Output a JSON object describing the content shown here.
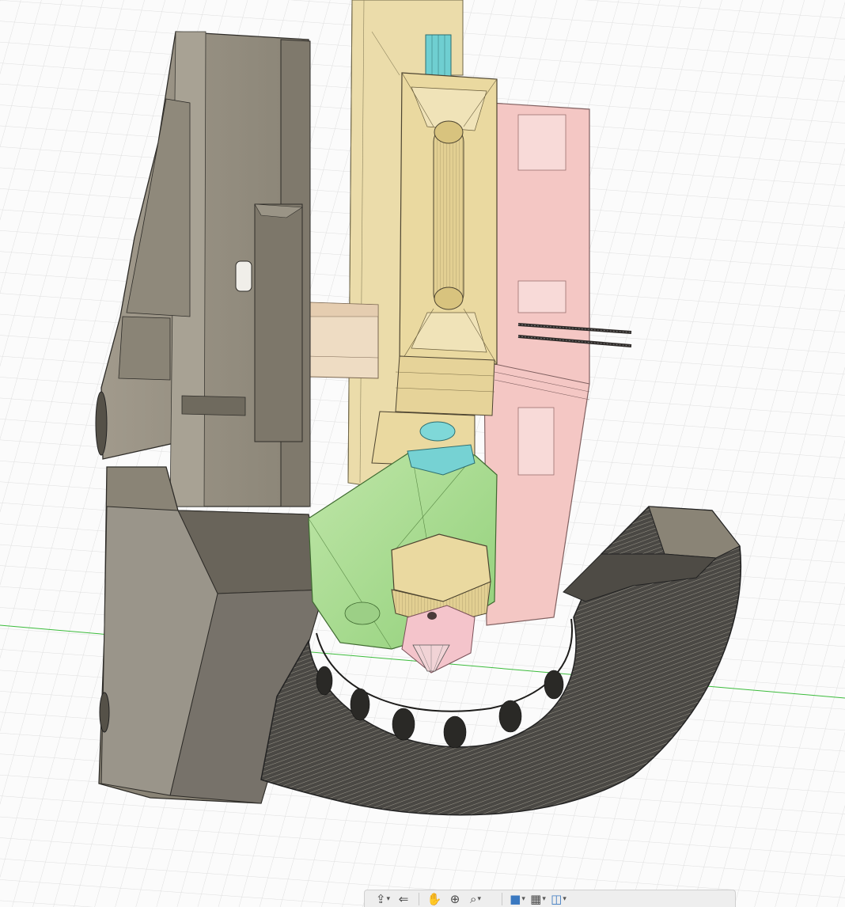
{
  "app": {
    "view": "3D model viewport"
  },
  "colors": {
    "background": "#fbfbfb",
    "grid": "#dcdcdc",
    "gray_part": "#8e887c",
    "yellow_part": "#e9d9a2",
    "pink_part": "#f3c3c1",
    "green_part": "#a6dc90",
    "teal_part": "#6fcfd1",
    "dark_duct": "#3b3a37",
    "axis_line": "#3cbc3c"
  },
  "toolbar": {
    "buttons": [
      {
        "name": "orbit-icon",
        "glyph": "⇪",
        "caret": "▾"
      },
      {
        "name": "look-at-icon",
        "glyph": "⇐",
        "caret": ""
      },
      {
        "name": "pan-hand-icon",
        "glyph": "✋",
        "caret": ""
      },
      {
        "name": "zoom-icon",
        "glyph": "⊕",
        "caret": ""
      },
      {
        "name": "fit-icon",
        "glyph": "⌕",
        "caret": "▾"
      },
      {
        "name": "display-settings-icon",
        "glyph": "■",
        "caret": "▾"
      },
      {
        "name": "grid-settings-icon",
        "glyph": "▦",
        "caret": "▾"
      },
      {
        "name": "viewports-icon",
        "glyph": "◫",
        "caret": "▾"
      }
    ]
  }
}
